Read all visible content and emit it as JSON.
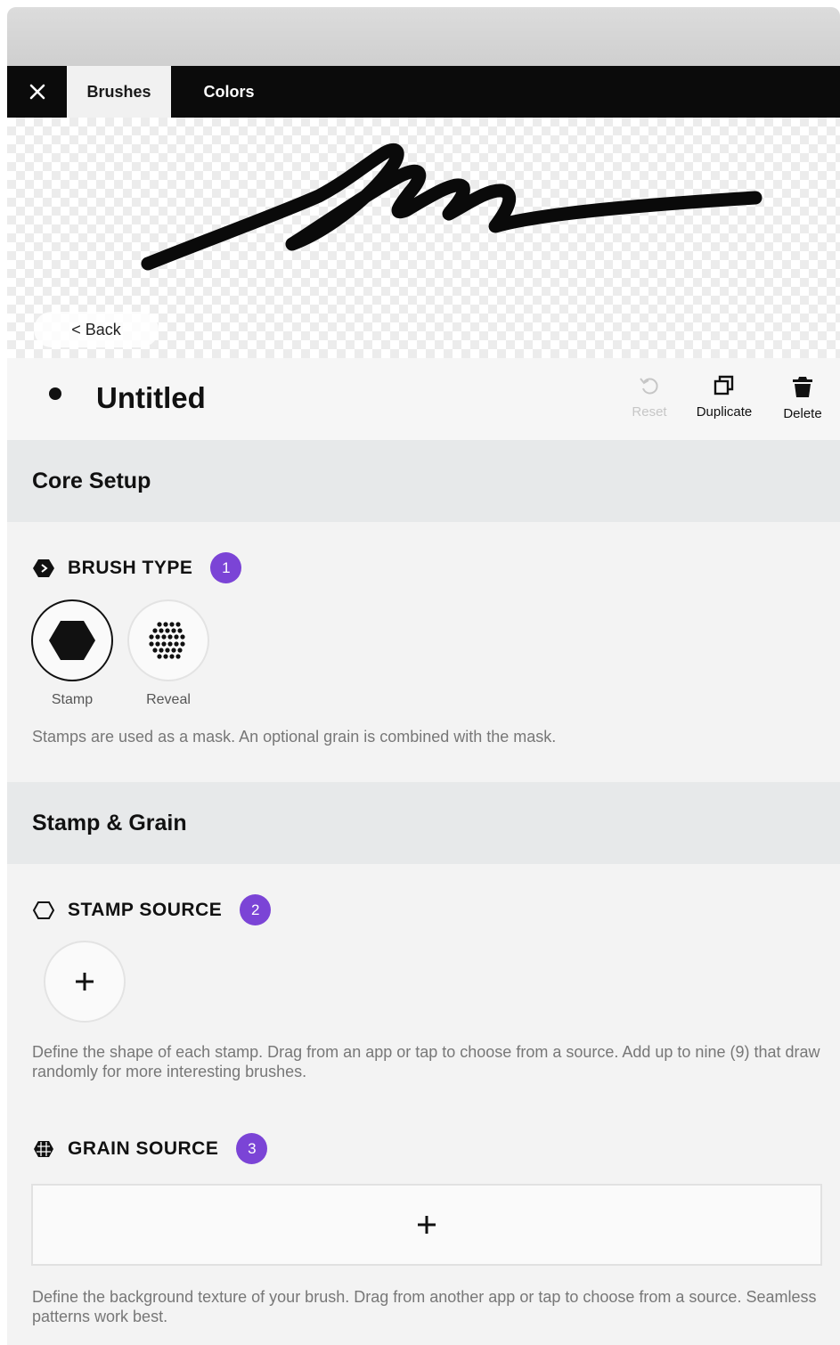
{
  "tabs": [
    {
      "label": "Brushes",
      "active": true
    },
    {
      "label": "Colors",
      "active": false
    }
  ],
  "canvas": {
    "back_label": "< Back"
  },
  "brush": {
    "title": "Untitled"
  },
  "actions": {
    "reset": "Reset",
    "duplicate": "Duplicate",
    "delete": "Delete"
  },
  "sections": {
    "core": {
      "title": "Core Setup",
      "brush_type": {
        "label": "BRUSH TYPE",
        "badge": "1",
        "options": [
          {
            "label": "Stamp",
            "selected": true
          },
          {
            "label": "Reveal",
            "selected": false
          }
        ],
        "description": "Stamps are used as a mask. An optional grain is combined with the mask."
      }
    },
    "stamp_grain": {
      "title": "Stamp & Grain",
      "stamp_source": {
        "label": "STAMP SOURCE",
        "badge": "2",
        "description": "Define the shape of each stamp. Drag from an app or tap to choose from a source. Add up to nine (9) that draw randomly for more interesting brushes."
      },
      "grain_source": {
        "label": "GRAIN SOURCE",
        "badge": "3",
        "description": "Define the background texture of your brush. Drag from another app or tap to choose from a source. Seamless patterns work best."
      }
    }
  },
  "colors": {
    "accent_badge": "#7b44d6",
    "tabbar": "#0b0b0b",
    "section_bg": "#e7e9ea"
  },
  "icons": [
    "close-icon",
    "reset-icon",
    "duplicate-icon",
    "trash-icon",
    "brush-type-icon",
    "hexagon-stamp-icon",
    "reveal-dots-icon",
    "hexagon-outline-icon",
    "grain-icon",
    "plus-icon"
  ]
}
